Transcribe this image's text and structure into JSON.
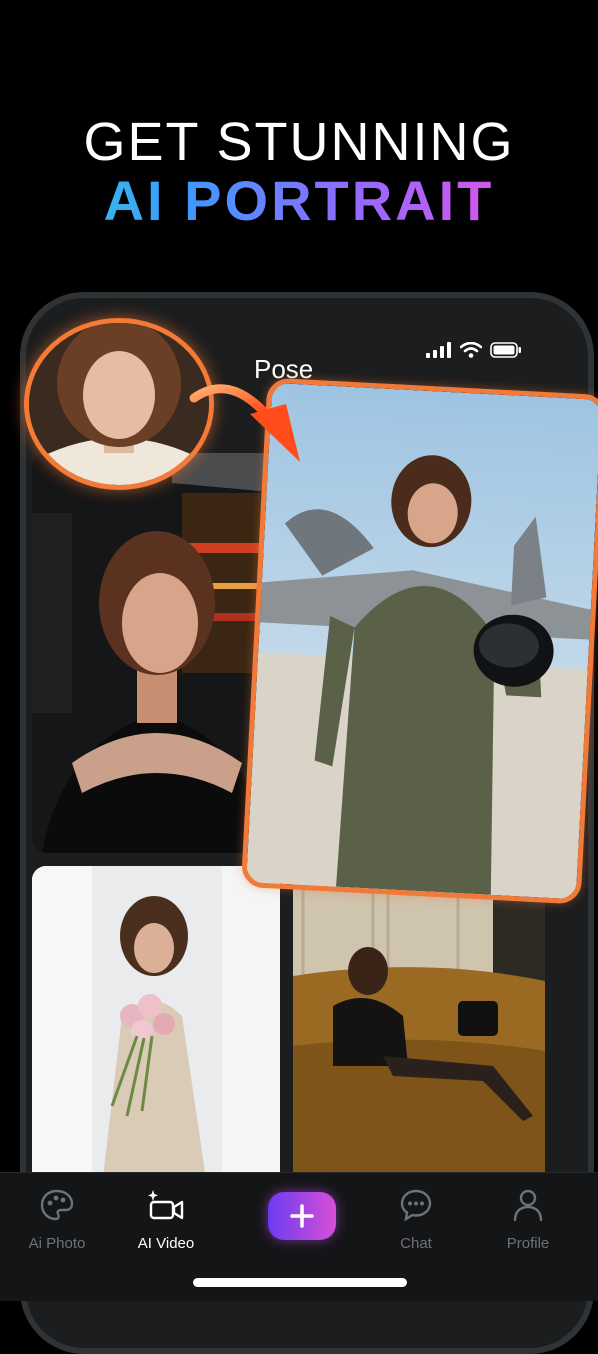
{
  "headline": {
    "line1": "GET STUNNING",
    "line2": "AI PORTRAIT"
  },
  "mockup": {
    "pose_label": "Pose"
  },
  "status_icons": [
    "signal-icon",
    "wifi-icon",
    "battery-icon"
  ],
  "tabs": [
    {
      "label": "Ai Photo",
      "icon": "palette-icon",
      "active": false
    },
    {
      "label": "AI Video",
      "icon": "video-sparkle-icon",
      "active": true
    },
    {
      "label": "",
      "icon": "plus-icon",
      "active": false
    },
    {
      "label": "Chat",
      "icon": "chat-bubble-icon",
      "active": false
    },
    {
      "label": "Profile",
      "icon": "person-icon",
      "active": false
    }
  ],
  "colors": {
    "accent_orange": "#f57a36",
    "gradient_start": "#35d6d0",
    "gradient_end": "#f054c8",
    "plus_gradient_start": "#6b3cf0",
    "plus_gradient_end": "#d74fd8"
  }
}
